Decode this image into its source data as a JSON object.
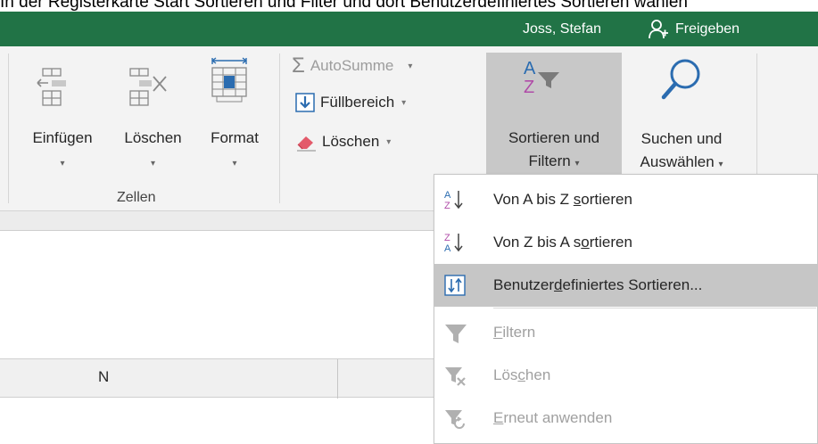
{
  "caption": "In der Registerkarte Start Sortieren und Filter und dort Benutzerdefiniertes Sortieren wählen",
  "titlebar": {
    "user": "Joss, Stefan",
    "share": "Freigeben"
  },
  "ribbon": {
    "cells_group": {
      "label": "Zellen",
      "insert": "Einfügen",
      "delete": "Löschen",
      "format": "Format"
    },
    "editing": {
      "autosum": "AutoSumme",
      "fill": "Füllbereich",
      "clear": "Löschen",
      "sort_line1": "Sortieren und",
      "sort_line2": "Filtern",
      "find_line1": "Suchen und",
      "find_line2": "Auswählen"
    }
  },
  "sheet": {
    "column_label": "N"
  },
  "menu": {
    "items": [
      {
        "pre": "Von A bis Z ",
        "ul": "s",
        "post": "ortieren",
        "icon": "sort-a-z-icon",
        "disabled": false
      },
      {
        "pre": "Von Z bis A s",
        "ul": "o",
        "post": "rtieren",
        "icon": "sort-z-a-icon",
        "disabled": false
      },
      {
        "pre": "Benutzer",
        "ul": "d",
        "post": "efiniertes Sortieren...",
        "icon": "custom-sort-icon",
        "disabled": false,
        "highlighted": true
      },
      {
        "pre": "",
        "ul": "F",
        "post": "iltern",
        "icon": "filter-icon",
        "disabled": true
      },
      {
        "pre": "Lös",
        "ul": "c",
        "post": "hen",
        "icon": "clear-filter-icon",
        "disabled": true
      },
      {
        "pre": "",
        "ul": "E",
        "post": "rneut anwenden",
        "icon": "reapply-filter-icon",
        "disabled": true
      }
    ]
  },
  "colors": {
    "accent": "#217346",
    "ribbon_bg": "#f3f3f3",
    "pressed": "#c8c8c8",
    "highlight": "#c6c6c6"
  }
}
